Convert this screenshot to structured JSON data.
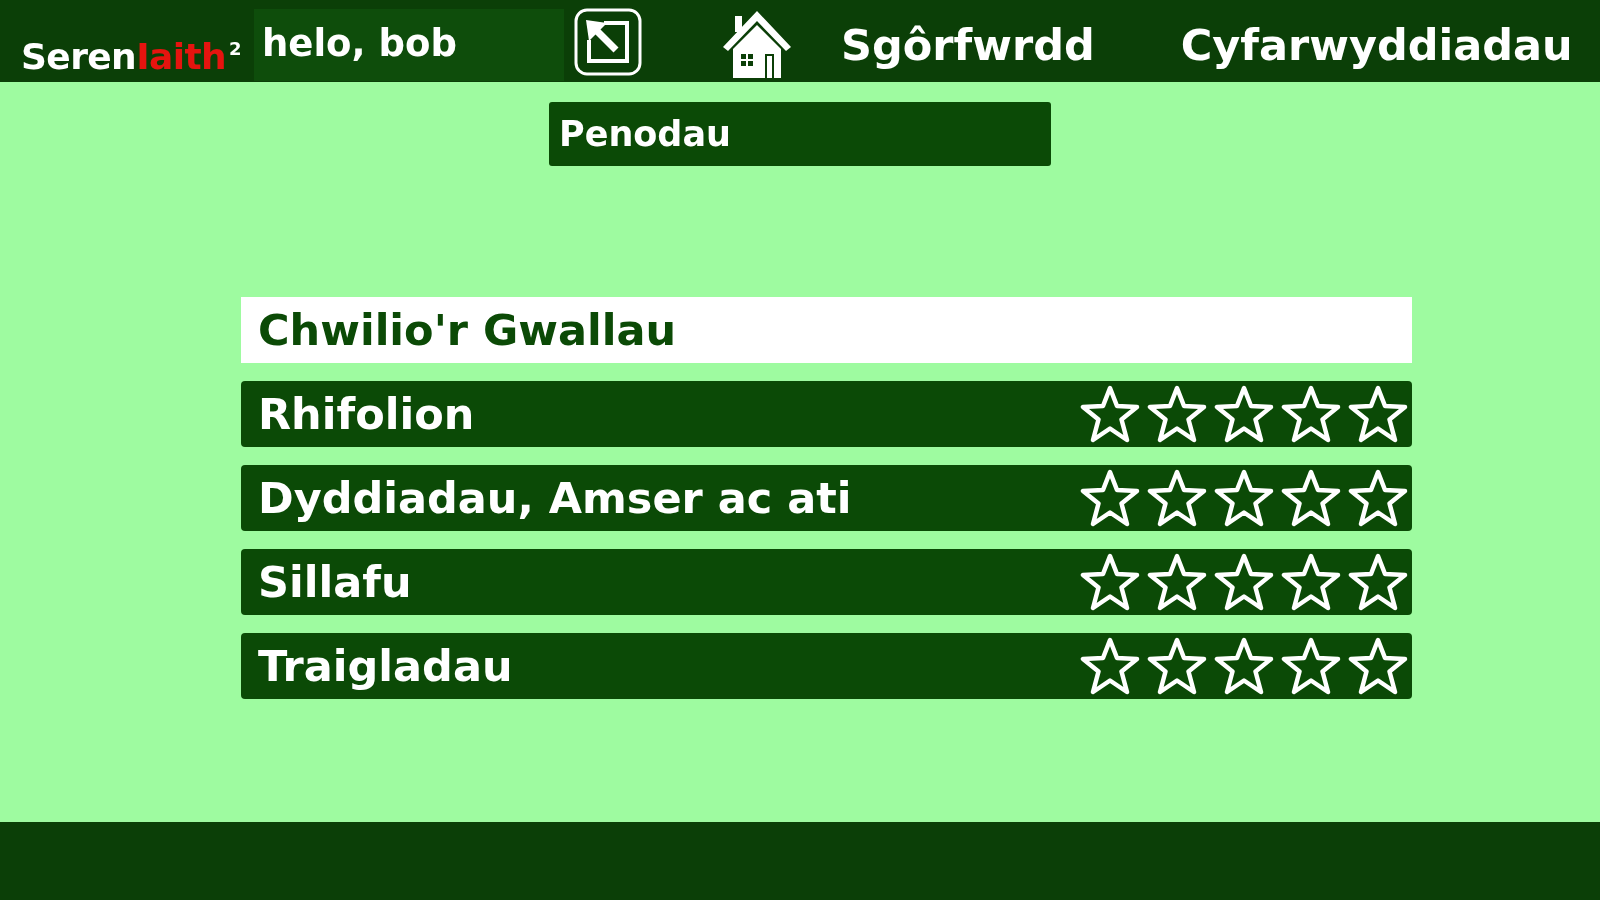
{
  "header": {
    "logo": {
      "parts": [
        "Seren",
        "Iaith"
      ],
      "superscript": "2"
    },
    "greeting": "helo, bob",
    "nav": [
      "Sgôrfwrdd",
      "Cyfarwyddiadau"
    ]
  },
  "section_title": "Penodau",
  "chapters": [
    {
      "title": "Chwilio'r Gwallau",
      "selected": true
    },
    {
      "title": "Rhifolion",
      "selected": false,
      "stars": 0
    },
    {
      "title": "Dyddiadau, Amser ac ati",
      "selected": false,
      "stars": 0
    },
    {
      "title": "Sillafu",
      "selected": false,
      "stars": 0
    },
    {
      "title": "Traigladau",
      "selected": false,
      "stars": 0
    }
  ]
}
